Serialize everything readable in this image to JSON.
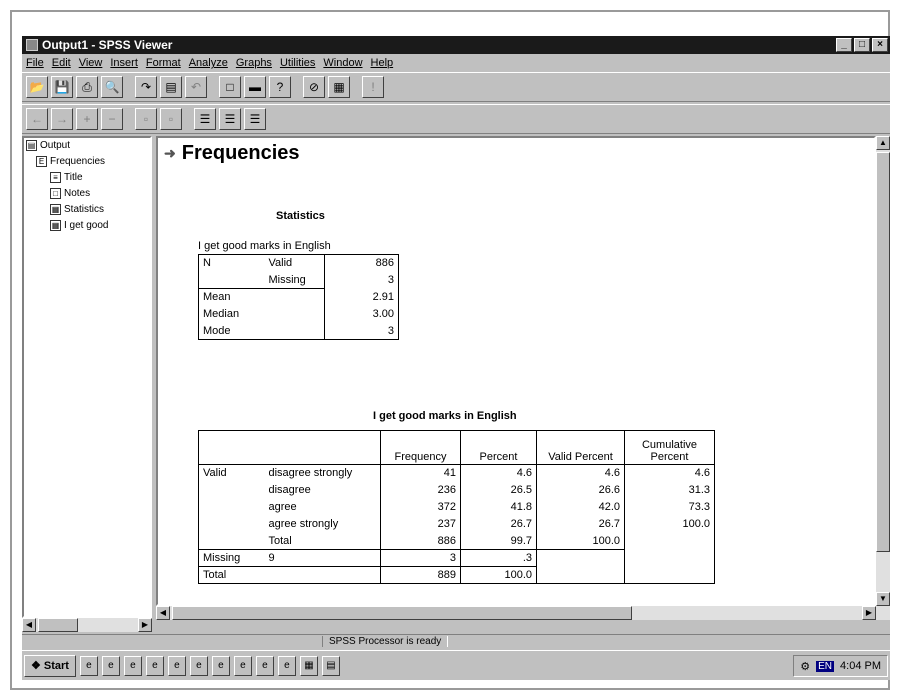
{
  "window": {
    "title": "Output1 - SPSS Viewer",
    "controls": [
      "_",
      "□",
      "×"
    ]
  },
  "menu": [
    "File",
    "Edit",
    "View",
    "Insert",
    "Format",
    "Analyze",
    "Graphs",
    "Utilities",
    "Window",
    "Help"
  ],
  "outline": {
    "items": [
      {
        "label": "Output",
        "icon": "output-icon"
      },
      {
        "label": "Frequencies",
        "icon": "book-icon"
      },
      {
        "label": "Title",
        "icon": "title-icon"
      },
      {
        "label": "Notes",
        "icon": "notes-icon"
      },
      {
        "label": "Statistics",
        "icon": "table-icon"
      },
      {
        "label": "I get good",
        "icon": "table-icon"
      }
    ]
  },
  "content": {
    "heading": "Frequencies",
    "statistics": {
      "title": "Statistics",
      "caption": "I get good marks in English",
      "rows": [
        {
          "a": "N",
          "b": "Valid",
          "v": "886"
        },
        {
          "a": "",
          "b": "Missing",
          "v": "3"
        },
        {
          "a": "Mean",
          "b": "",
          "v": "2.91"
        },
        {
          "a": "Median",
          "b": "",
          "v": "3.00"
        },
        {
          "a": "Mode",
          "b": "",
          "v": "3"
        }
      ]
    },
    "frequency": {
      "title": "I get good marks in English",
      "headers": [
        "",
        "",
        "Frequency",
        "Percent",
        "Valid Percent",
        "Cumulative Percent"
      ],
      "rows": [
        [
          "Valid",
          "disagree strongly",
          "41",
          "4.6",
          "4.6",
          "4.6"
        ],
        [
          "",
          "disagree",
          "236",
          "26.5",
          "26.6",
          "31.3"
        ],
        [
          "",
          "agree",
          "372",
          "41.8",
          "42.0",
          "73.3"
        ],
        [
          "",
          "agree strongly",
          "237",
          "26.7",
          "26.7",
          "100.0"
        ],
        [
          "",
          "Total",
          "886",
          "99.7",
          "100.0",
          ""
        ],
        [
          "Missing",
          "9",
          "3",
          ".3",
          "",
          ""
        ],
        [
          "Total",
          "",
          "889",
          "100.0",
          "",
          ""
        ]
      ]
    }
  },
  "status": {
    "text": "SPSS Processor  is ready"
  },
  "taskbar": {
    "start_label": "Start",
    "tray_lang": "EN",
    "clock": "4:04 PM"
  }
}
